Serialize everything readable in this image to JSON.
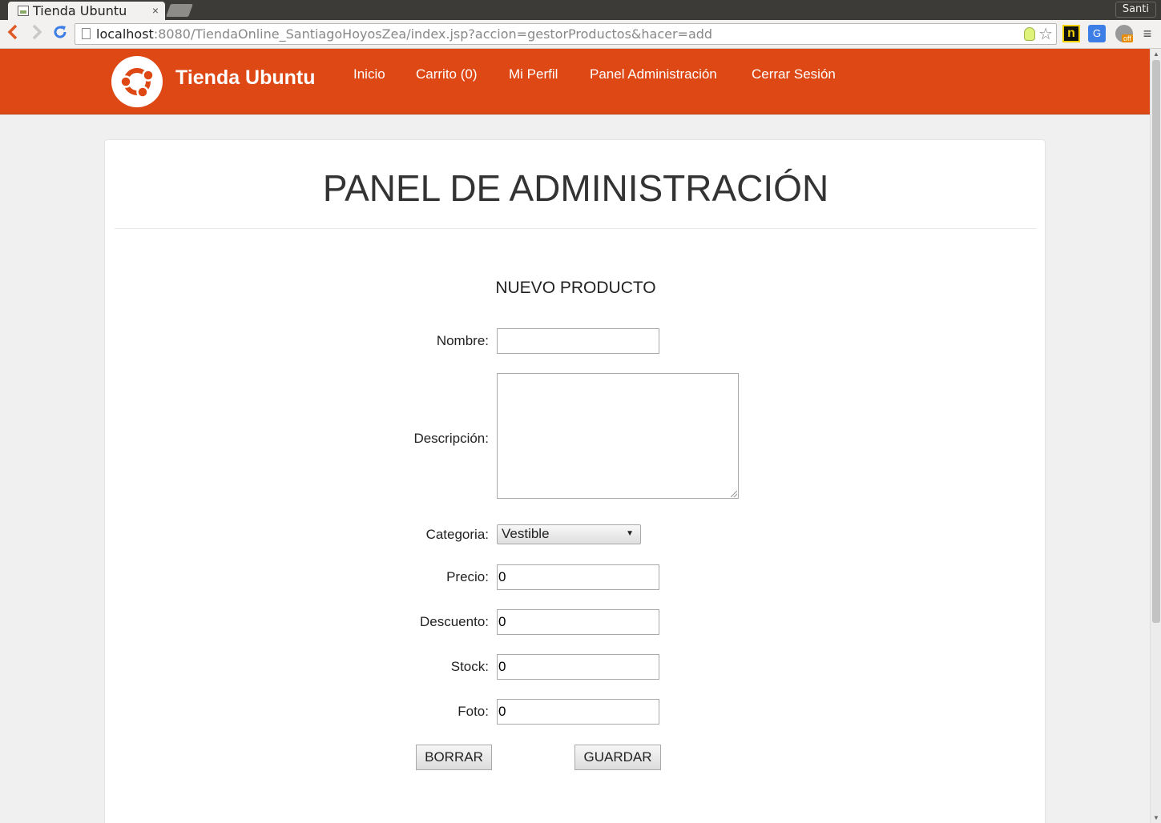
{
  "browser": {
    "tab_title": "Tienda Ubuntu",
    "tab_close": "×",
    "user": "Santi",
    "url_host": "localhost",
    "url_rest": ":8080/TiendaOnline_SantiagoHoyosZea/index.jsp?accion=gestorProductos&hacer=add",
    "ext_label": "n",
    "translate_label": "G",
    "off_label": "off"
  },
  "site": {
    "brand": "Tienda Ubuntu",
    "nav": [
      "Inicio",
      "Carrito (0)",
      "Mi Perfil",
      "Panel Administración",
      "Cerrar Sesión"
    ],
    "brand_color": "#dd4814"
  },
  "panel": {
    "title": "PANEL DE ADMINISTRACIÓN",
    "subtitle": "NUEVO PRODUCTO"
  },
  "form": {
    "nombre_label": "Nombre:",
    "nombre_value": "",
    "descripcion_label": "Descripción:",
    "categoria_label": "Categoria:",
    "categoria_value": "Vestible",
    "precio_label": "Precio:",
    "precio_value": "0",
    "descuento_label": "Descuento:",
    "descuento_value": "0",
    "stock_label": "Stock:",
    "stock_value": "0",
    "foto_label": "Foto:",
    "foto_value": "0",
    "borrar_label": "BORRAR",
    "guardar_label": "GUARDAR"
  }
}
